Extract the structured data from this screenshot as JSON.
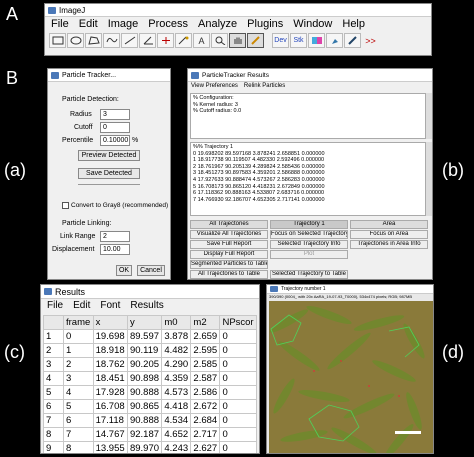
{
  "panel_labels": {
    "a": "A",
    "b": "B",
    "c": "(a)",
    "d": "(b)",
    "e": "(c)",
    "f": "(d)"
  },
  "imagej": {
    "title": "ImageJ",
    "menu": [
      "File",
      "Edit",
      "Image",
      "Process",
      "Analyze",
      "Plugins",
      "Window",
      "Help"
    ],
    "tools": [
      "rectangle-tool",
      "oval-tool",
      "polygon-tool",
      "freehand-tool",
      "straight-line-tool",
      "angle-tool",
      "point-tool",
      "wand-tool",
      "text-tool",
      "magnifier-tool",
      "hand-tool",
      "color-picker-tool",
      "dev-tool",
      "stack-tool",
      "lut-tool",
      "brush-tool",
      "dropper-tool",
      "more-tools"
    ],
    "text_tool_label": "A",
    "dev_label": "Dev",
    "stack_label": "Stk",
    "more_label": ">>"
  },
  "tracker": {
    "title": "Particle Tracker...",
    "detection_heading": "Particle Detection:",
    "radius_label": "Radius",
    "radius_value": "3",
    "cutoff_label": "Cutoff",
    "cutoff_value": "0",
    "percentile_label": "Percentile",
    "percentile_value": "0.10000",
    "percentile_unit": "%",
    "preview_button": "Preview Detected",
    "save_button": "Save Detected",
    "convert_label": "Convert to Gray8 (recommended)",
    "linking_heading": "Particle Linking:",
    "link_range_label": "Link Range",
    "link_range_value": "2",
    "displacement_label": "Displacement",
    "displacement_value": "10.00",
    "ok_button": "OK",
    "cancel_button": "Cancel"
  },
  "results_window": {
    "title": "ParticleTracker Results",
    "menu": [
      "View Preferences",
      "Relink Particles"
    ],
    "config_lines": [
      "% Configuration:",
      "% Kernel radius: 3",
      "% Cutoff radius: 0.0"
    ],
    "trajectory_heading": "%% Trajectory 1",
    "trajectory_lines": [
      "0 19.698202 89.597168 3.878241 2.658851 0.000000",
      "1 18.917738 90.119507 4.482330 2.592496 0.000000",
      "2 18.761967 90.205139 4.289824 2.585436 0.000000",
      "3 18.451273 90.897583 4.359201 2.586888 0.000000",
      "4 17.927633 90.888474 4.573267 2.586283 0.000000",
      "5 16.708173 90.865120 4.418231 2.672849 0.000000",
      "6 17.118362 90.888163 4.533807 2.683716 0.000000",
      "7 14.766930 92.186707 4.652305 2.717141 0.000000"
    ],
    "buttons": [
      [
        "All Trajectories",
        "Trajectory 1",
        "Area"
      ],
      [
        "Visualize All Trajectories",
        "Focus on Selected Trajectory",
        "Focus on Area"
      ],
      [
        "Save Full Report",
        "Selected Trajectory Info",
        "Trajectories in Area Info"
      ],
      [
        "Display Full Report",
        "Plot",
        ""
      ],
      [
        "Segmented Particles to Table",
        "",
        ""
      ],
      [
        "All Trajectories to Table",
        "Selected Trajectory to Table",
        ""
      ]
    ]
  },
  "results_table": {
    "title": "Results",
    "menu": [
      "File",
      "Edit",
      "Font",
      "Results"
    ],
    "headers": [
      "",
      "frame",
      "x",
      "y",
      "m0",
      "m2",
      "NPscor"
    ],
    "rows": [
      [
        "1",
        "0",
        "19.698",
        "89.597",
        "3.878",
        "2.659",
        "0"
      ],
      [
        "2",
        "1",
        "18.918",
        "90.119",
        "4.482",
        "2.595",
        "0"
      ],
      [
        "3",
        "2",
        "18.762",
        "90.205",
        "4.290",
        "2.585",
        "0"
      ],
      [
        "4",
        "3",
        "18.451",
        "90.898",
        "4.359",
        "2.587",
        "0"
      ],
      [
        "5",
        "4",
        "17.928",
        "90.888",
        "4.573",
        "2.586",
        "0"
      ],
      [
        "6",
        "5",
        "16.708",
        "90.865",
        "4.418",
        "2.672",
        "0"
      ],
      [
        "7",
        "6",
        "17.118",
        "90.888",
        "4.534",
        "2.684",
        "0"
      ],
      [
        "8",
        "7",
        "14.767",
        "92.187",
        "4.652",
        "2.717",
        "0"
      ],
      [
        "9",
        "8",
        "13.955",
        "89.970",
        "4.243",
        "2.627",
        "0"
      ]
    ]
  },
  "trajectory_view": {
    "title": "Trajectory number 1",
    "subtitle": "390/390 (0004_ with 20x AaRA_19-07-93_T0000), 534x474 pixels; RGB; 987MB",
    "colors": {
      "background": "#8a7a3a",
      "cell": "#6f8a2c",
      "track": "#4fd25a",
      "scalebar": "#ffffff"
    }
  }
}
